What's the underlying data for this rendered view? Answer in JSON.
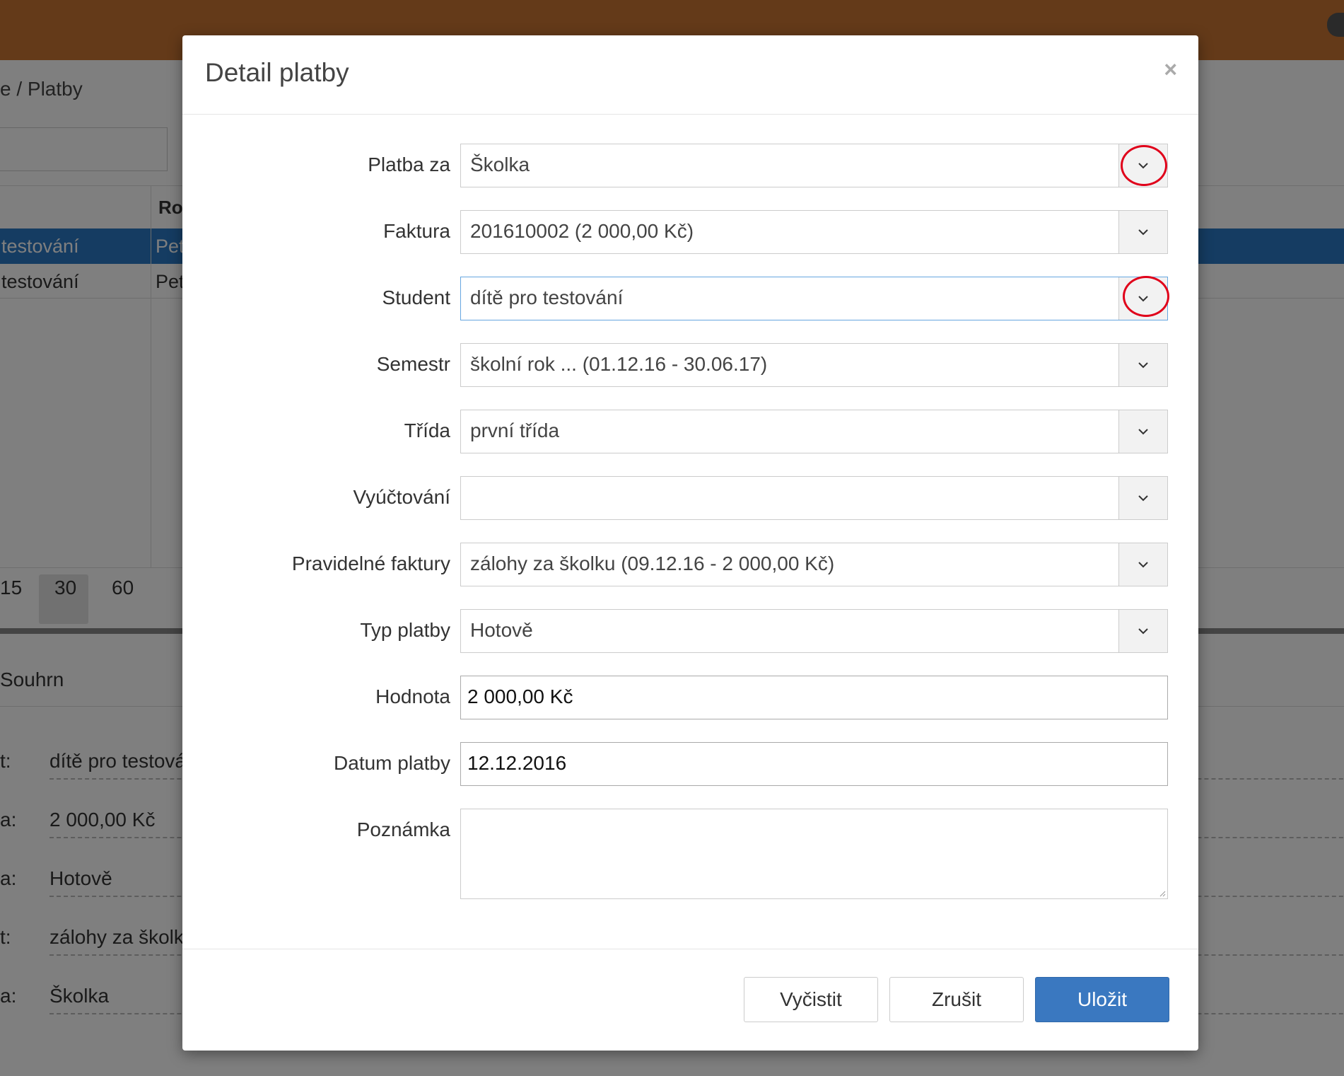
{
  "background": {
    "breadcrumb": "e / Platby",
    "search_value": "",
    "table_header": "Ro",
    "rows": [
      {
        "name": "testování",
        "col2": "Pet"
      },
      {
        "name": "testování",
        "col2": "Pet"
      }
    ],
    "pager": [
      "15",
      "30",
      "60"
    ],
    "summary_title": "Souhrn",
    "summary": [
      {
        "label": "t:",
        "value": "dítě pro testová"
      },
      {
        "label": "a:",
        "value": "2 000,00 Kč"
      },
      {
        "label": "a:",
        "value": "Hotově"
      },
      {
        "label": "t:",
        "value": "zálohy za školku"
      },
      {
        "label": "a:",
        "value": "Školka"
      }
    ]
  },
  "modal": {
    "title": "Detail platby",
    "close_label": "×",
    "fields": {
      "platba_za": {
        "label": "Platba za",
        "value": "Školka"
      },
      "faktura": {
        "label": "Faktura",
        "value": "201610002 (2 000,00 Kč)"
      },
      "student": {
        "label": "Student",
        "value": "dítě pro testování"
      },
      "semestr": {
        "label": "Semestr",
        "value": "školní rok ... (01.12.16 - 30.06.17)"
      },
      "trida": {
        "label": "Třída",
        "value": "první třída"
      },
      "vyuctovani": {
        "label": "Vyúčtování",
        "value": ""
      },
      "pravidelne_faktury": {
        "label": "Pravidelné faktury",
        "value": "zálohy za školku (09.12.16 - 2 000,00 Kč)"
      },
      "typ_platby": {
        "label": "Typ platby",
        "value": "Hotově"
      },
      "hodnota": {
        "label": "Hodnota",
        "value": "2 000,00 Kč"
      },
      "datum_platby": {
        "label": "Datum platby",
        "value": "12.12.2016"
      },
      "poznamka": {
        "label": "Poznámka",
        "value": ""
      }
    },
    "buttons": {
      "clear": "Vyčistit",
      "cancel": "Zrušit",
      "save": "Uložit"
    }
  },
  "colors": {
    "topbar": "#c87533",
    "primary": "#3a78c0",
    "annotation": "#e0001a",
    "selected_row": "#2a78c4"
  },
  "icons": [
    "chevron-down-icon",
    "close-icon",
    "resize-grip-icon"
  ]
}
